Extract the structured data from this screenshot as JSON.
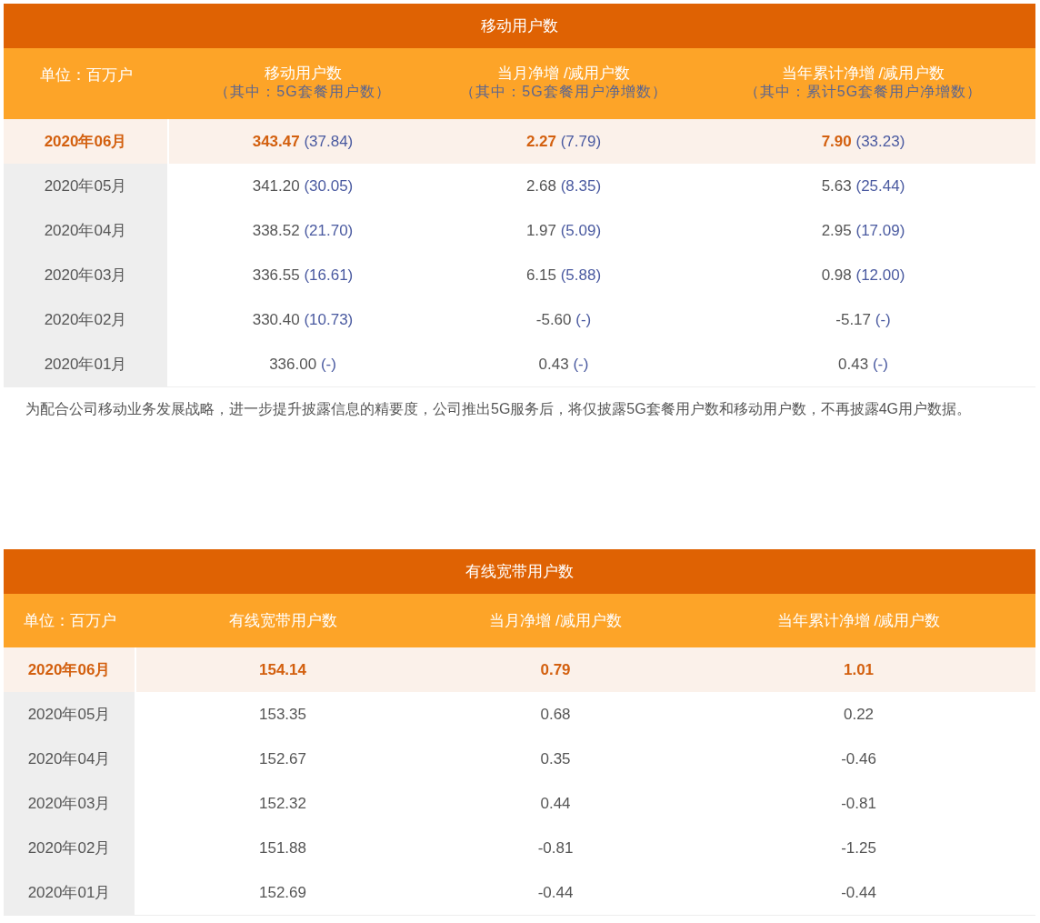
{
  "tables": [
    {
      "title": "移动用户数",
      "columns": [
        {
          "label": "单位：百万户"
        },
        {
          "label": "移动用户数",
          "sublabel": "（其中：5G套餐用户数）"
        },
        {
          "label": "当月净增 /减用户数",
          "sublabel": "（其中：5G套餐用户净增数）"
        },
        {
          "label": "当年累计净增 /减用户数",
          "sublabel": "（其中：累计5G套餐用户净增数）"
        }
      ],
      "rows": [
        {
          "highlighted": true,
          "cells": [
            {
              "value": "2020年06月"
            },
            {
              "value": "343.47",
              "sub": "(37.84)"
            },
            {
              "value": "2.27",
              "sub": "(7.79)"
            },
            {
              "value": "7.90",
              "sub": "(33.23)"
            }
          ]
        },
        {
          "highlighted": false,
          "cells": [
            {
              "value": "2020年05月"
            },
            {
              "value": "341.20",
              "sub": "(30.05)"
            },
            {
              "value": "2.68",
              "sub": "(8.35)"
            },
            {
              "value": "5.63",
              "sub": "(25.44)"
            }
          ]
        },
        {
          "highlighted": false,
          "cells": [
            {
              "value": "2020年04月"
            },
            {
              "value": "338.52",
              "sub": "(21.70)"
            },
            {
              "value": "1.97",
              "sub": "(5.09)"
            },
            {
              "value": "2.95",
              "sub": "(17.09)"
            }
          ]
        },
        {
          "highlighted": false,
          "cells": [
            {
              "value": "2020年03月"
            },
            {
              "value": "336.55",
              "sub": "(16.61)"
            },
            {
              "value": "6.15",
              "sub": "(5.88)"
            },
            {
              "value": "0.98",
              "sub": "(12.00)"
            }
          ]
        },
        {
          "highlighted": false,
          "cells": [
            {
              "value": "2020年02月"
            },
            {
              "value": "330.40",
              "sub": "(10.73)"
            },
            {
              "value": "-5.60",
              "sub": "(-)"
            },
            {
              "value": "-5.17",
              "sub": "(-)"
            }
          ]
        },
        {
          "highlighted": false,
          "cells": [
            {
              "value": "2020年01月"
            },
            {
              "value": "336.00",
              "sub": "(-)"
            },
            {
              "value": "0.43",
              "sub": "(-)"
            },
            {
              "value": "0.43",
              "sub": "(-)"
            }
          ]
        }
      ],
      "note": "为配合公司移动业务发展战略，进一步提升披露信息的精要度，公司推出5G服务后，将仅披露5G套餐用户数和移动用户数，不再披露4G用户数据。"
    },
    {
      "title": "有线宽带用户数",
      "columns": [
        {
          "label": "单位：百万户"
        },
        {
          "label": "有线宽带用户数"
        },
        {
          "label": "当月净增 /减用户数"
        },
        {
          "label": "当年累计净增 /减用户数"
        }
      ],
      "rows": [
        {
          "highlighted": true,
          "cells": [
            {
              "value": "2020年06月"
            },
            {
              "value": "154.14"
            },
            {
              "value": "0.79"
            },
            {
              "value": "1.01"
            }
          ]
        },
        {
          "highlighted": false,
          "cells": [
            {
              "value": "2020年05月"
            },
            {
              "value": "153.35"
            },
            {
              "value": "0.68"
            },
            {
              "value": "0.22"
            }
          ]
        },
        {
          "highlighted": false,
          "cells": [
            {
              "value": "2020年04月"
            },
            {
              "value": "152.67"
            },
            {
              "value": "0.35"
            },
            {
              "value": "-0.46"
            }
          ]
        },
        {
          "highlighted": false,
          "cells": [
            {
              "value": "2020年03月"
            },
            {
              "value": "152.32"
            },
            {
              "value": "0.44"
            },
            {
              "value": "-0.81"
            }
          ]
        },
        {
          "highlighted": false,
          "cells": [
            {
              "value": "2020年02月"
            },
            {
              "value": "151.88"
            },
            {
              "value": "-0.81"
            },
            {
              "value": "-1.25"
            }
          ]
        },
        {
          "highlighted": false,
          "cells": [
            {
              "value": "2020年01月"
            },
            {
              "value": "152.69"
            },
            {
              "value": "-0.44"
            },
            {
              "value": "-0.44"
            }
          ]
        }
      ]
    }
  ]
}
